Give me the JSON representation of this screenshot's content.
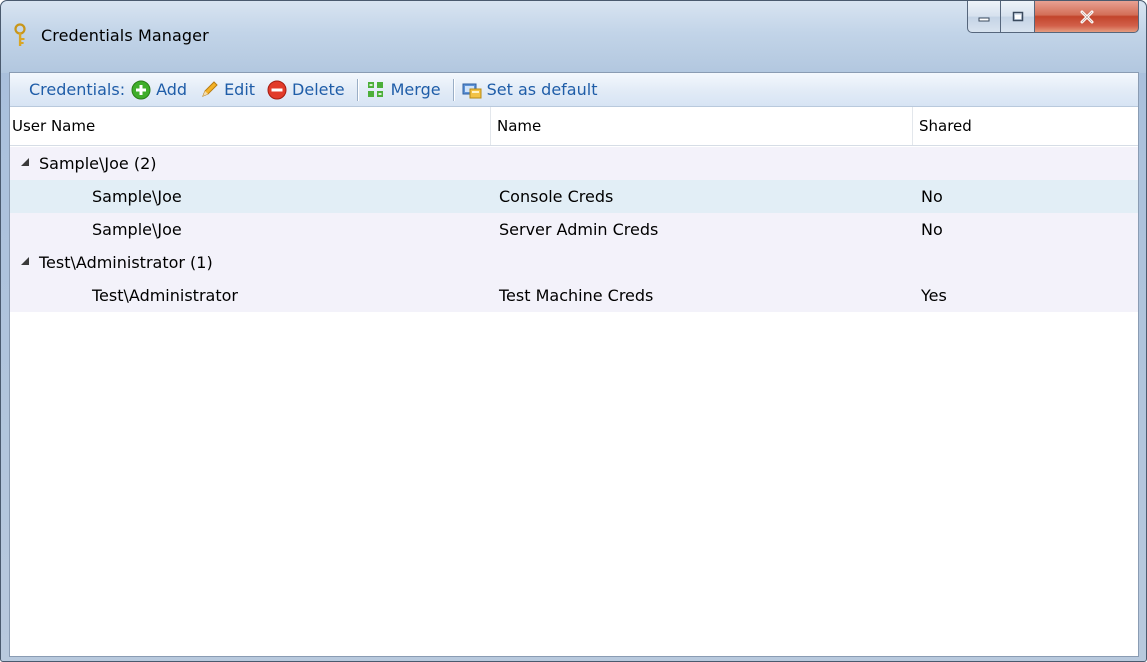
{
  "window": {
    "title": "Credentials Manager"
  },
  "toolbar": {
    "label": "Credentials:",
    "add": "Add",
    "edit": "Edit",
    "delete": "Delete",
    "merge": "Merge",
    "set_default": "Set as default"
  },
  "columns": {
    "user_name": "User Name",
    "name": "Name",
    "shared": "Shared"
  },
  "groups": [
    {
      "label": "Sample\\Joe (2)",
      "rows": [
        {
          "user": "Sample\\Joe",
          "name": "Console Creds",
          "shared": "No",
          "selected": true
        },
        {
          "user": "Sample\\Joe",
          "name": "Server Admin Creds",
          "shared": "No"
        }
      ]
    },
    {
      "label": "Test\\Administrator (1)",
      "rows": [
        {
          "user": "Test\\Administrator",
          "name": "Test Machine Creds",
          "shared": "Yes"
        }
      ]
    }
  ],
  "colors": {
    "toolbar_text": "#1f5da8",
    "selected_row": "#e2eef6",
    "row_bg": "#f3f2fa"
  },
  "icons": [
    "key-icon",
    "add-icon",
    "pencil-icon",
    "delete-icon",
    "merge-icon",
    "set-default-icon"
  ]
}
